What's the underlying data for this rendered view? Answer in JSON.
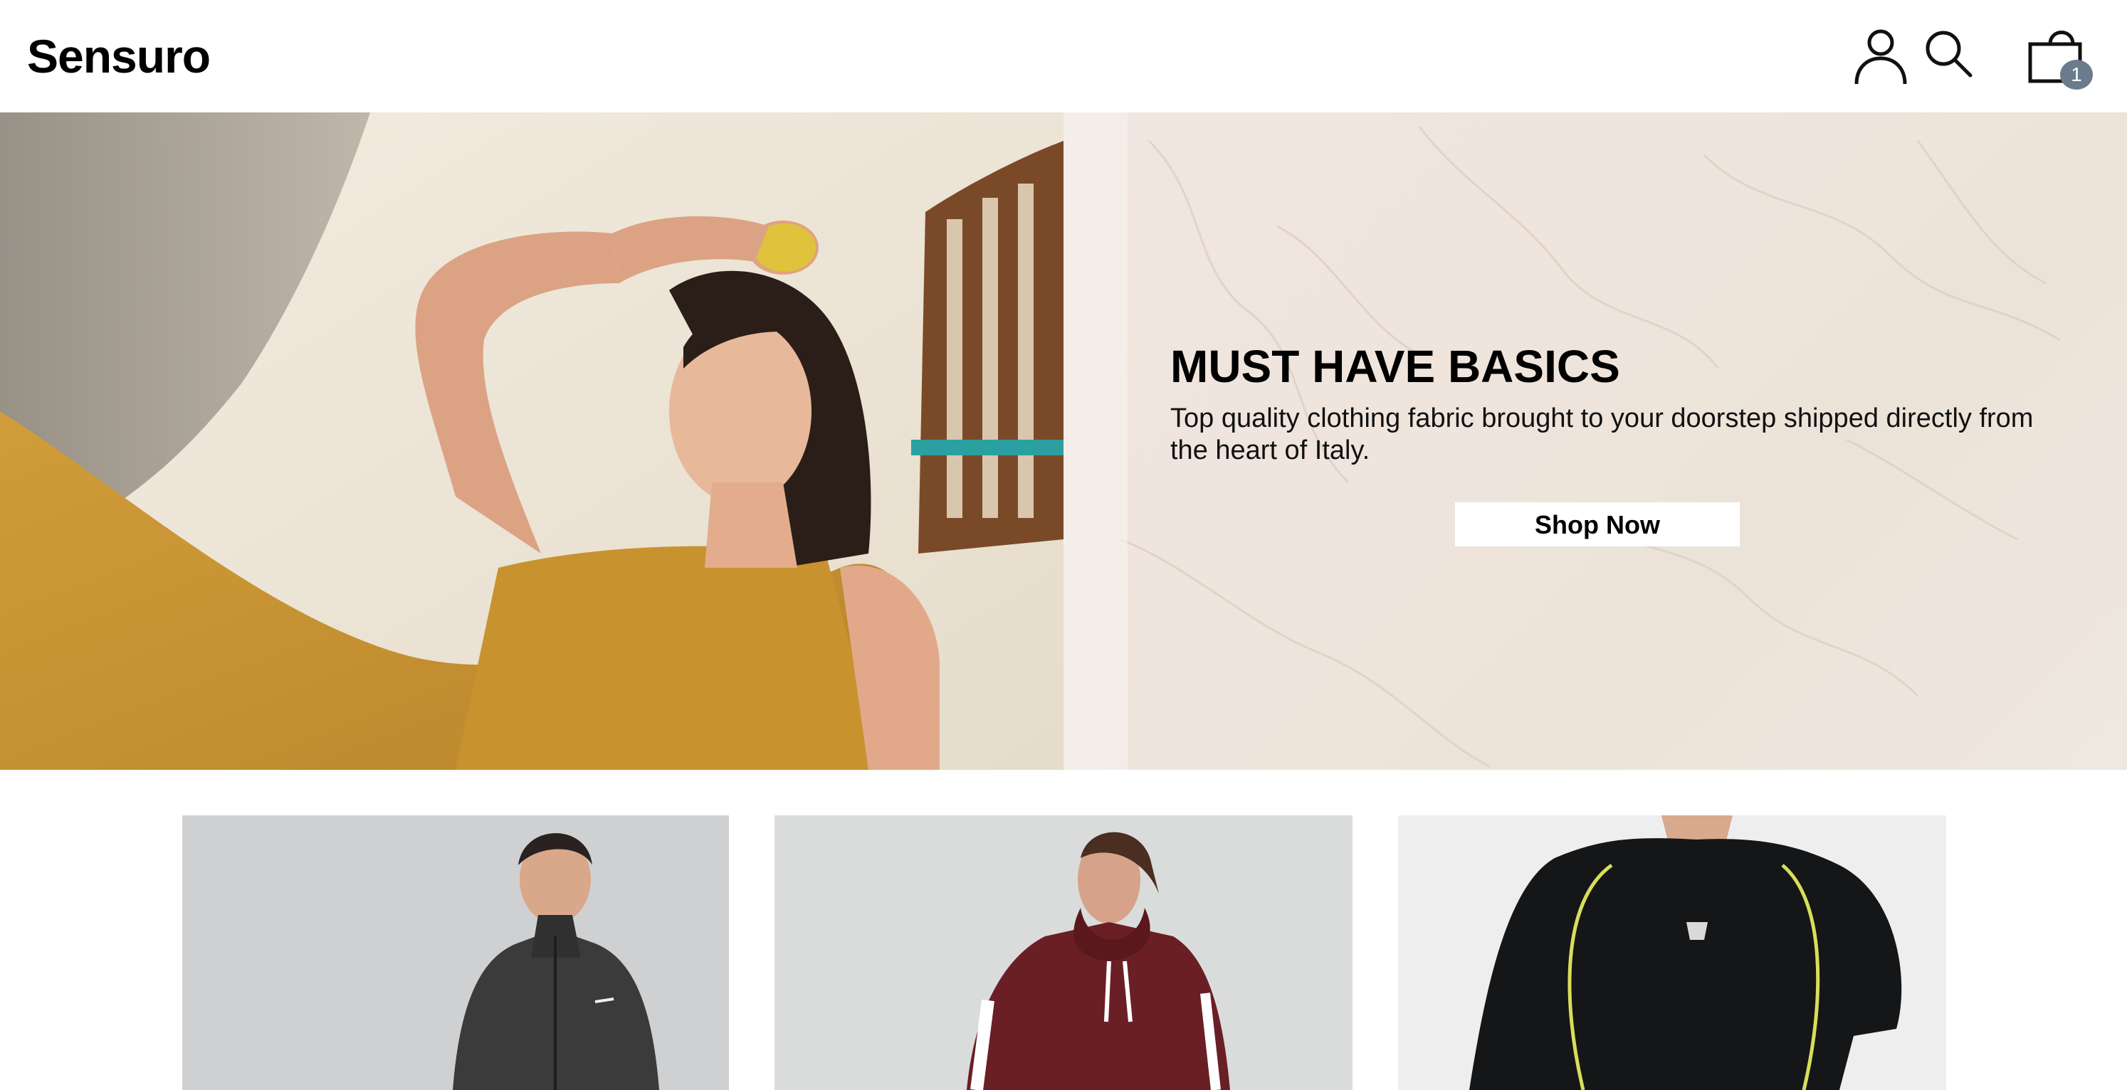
{
  "header": {
    "logo": "Sensuro",
    "icons": [
      "user-icon",
      "search-icon",
      "shopping-bag-icon"
    ],
    "cart_count": "1"
  },
  "hero": {
    "title": "MUST HAVE BASICS",
    "description": "Top quality clothing fabric brought to your doorstep shipped directly from the heart of Italy.",
    "cta_label": "Shop Now",
    "image": "woman-in-mustard-dress-photo"
  },
  "products": [
    {
      "image": "man-in-black-track-jacket-photo"
    },
    {
      "image": "woman-in-maroon-hoodie-photo"
    },
    {
      "image": "man-in-black-compression-shirt-photo"
    }
  ],
  "colors": {
    "badge": "#6b7b8c",
    "mustard": "#c9952f",
    "panel": "#efe5dd"
  }
}
